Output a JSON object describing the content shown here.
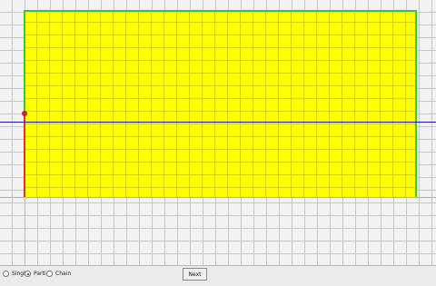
{
  "options": {
    "single_label": "Single",
    "partial_label": "Partial",
    "chain_label": "Chain",
    "selected": "Partial"
  },
  "toolbar": {
    "next_label": "Next"
  },
  "colors": {
    "shape_fill": "#ffff00",
    "edge_selected": "#3cc23c",
    "edge_active": "#e03030",
    "axis": "#1a1aa8"
  }
}
